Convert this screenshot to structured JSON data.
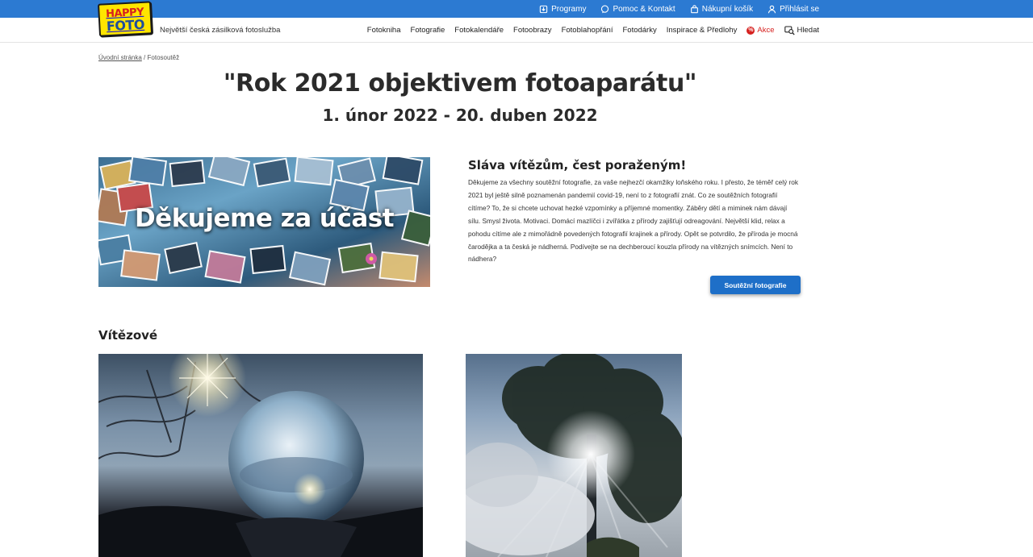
{
  "logo": {
    "line1": "HAPPY",
    "line2": "FOTO"
  },
  "topnav": [
    {
      "label": "Programy",
      "icon": "download-icon"
    },
    {
      "label": "Pomoc & Kontakt",
      "icon": "chat-icon"
    },
    {
      "label": "Nákupní košík",
      "icon": "cart-icon"
    },
    {
      "label": "Přihlásit se",
      "icon": "user-icon"
    }
  ],
  "tagline": "Největší česká zásilková fotoslužba",
  "mainnav": [
    {
      "label": "Fotokniha"
    },
    {
      "label": "Fotografie"
    },
    {
      "label": "Fotokalendáře"
    },
    {
      "label": "Fotoobrazy"
    },
    {
      "label": "Fotoblahopřání"
    },
    {
      "label": "Fotodárky"
    },
    {
      "label": "Inspirace & Předlohy"
    },
    {
      "label": "Akce",
      "badge": "%"
    },
    {
      "label": "Hledat",
      "icon": "search-icon"
    }
  ],
  "breadcrumb": {
    "home": "Úvodní stránka",
    "separator": "/",
    "current": "Fotosoutěž"
  },
  "title": "\"Rok 2021 objektivem fotoaparátu\"",
  "subtitle": "1. únor 2022 - 20. duben 2022",
  "banner": {
    "text": "Děkujeme za účast"
  },
  "intro": {
    "heading": "Sláva vítězům, čest poraženým!",
    "text": "Děkujeme za všechny soutěžní fotografie, za vaše nejhezčí okamžiky loňského roku. I přesto, že téměř celý rok 2021 byl ještě silně poznamenán pandemií covid-19, není to z fotografií znát. Co ze soutěžních fotografií cítíme? To, že si chcete uchovat hezké vzpomínky a příjemné momentky. Záběry dětí a miminek nám dávají sílu. Smysl života. Motivaci. Domácí mazlíčci i zvířátka z přírody zajišťují odreagování. Největší klid, relax a pohodu cítíme ale z mimořádně povedených fotografií krajinek a přírody. Opět se potvrdilo, že příroda je mocná čarodějka a ta česká je nádherná. Podívejte se na dechberoucí kouzla přírody na vítězných snímcích. Není to nádhera?",
    "button": "Soutěžní fotografie"
  },
  "winners": {
    "heading": "Vítězové"
  },
  "colors": {
    "topbar": "#2c7ad2",
    "accent": "#1e6fc8",
    "sale": "#d6211f",
    "logo_bg": "#ffe500"
  }
}
